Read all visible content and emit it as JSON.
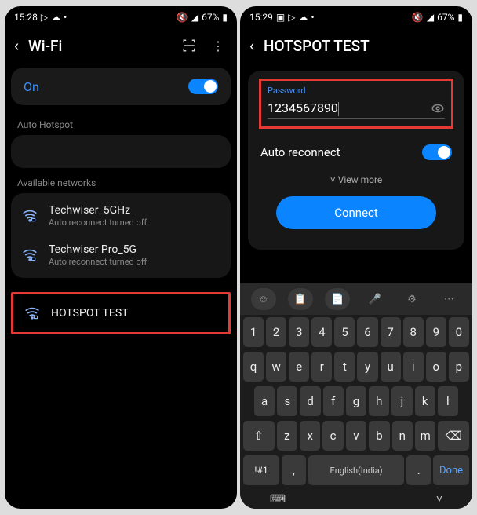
{
  "left": {
    "status": {
      "time": "15:28",
      "battery": "67%"
    },
    "header": {
      "title": "Wi-Fi"
    },
    "wifi_toggle": {
      "label": "On"
    },
    "auto_hotspot_label": "Auto Hotspot",
    "available_label": "Available networks",
    "networks": [
      {
        "name": "Techwiser_5GHz",
        "sub": "Auto reconnect turned off"
      },
      {
        "name": "Techwiser Pro_5G",
        "sub": "Auto reconnect turned off"
      }
    ],
    "highlighted_network": {
      "name": "HOTSPOT TEST"
    }
  },
  "right": {
    "status": {
      "time": "15:29",
      "battery": "67%"
    },
    "header": {
      "title": "HOTSPOT TEST"
    },
    "password": {
      "label": "Password",
      "value": "1234567890"
    },
    "auto_reconnect": {
      "label": "Auto reconnect"
    },
    "view_more": "View more",
    "connect": "Connect",
    "keyboard": {
      "row_num": [
        "1",
        "2",
        "3",
        "4",
        "5",
        "6",
        "7",
        "8",
        "9",
        "0"
      ],
      "row1": [
        "q",
        "w",
        "e",
        "r",
        "t",
        "y",
        "u",
        "i",
        "o",
        "p"
      ],
      "row2": [
        "a",
        "s",
        "d",
        "f",
        "g",
        "h",
        "j",
        "k",
        "l"
      ],
      "row3_shift": "⇧",
      "row3": [
        "z",
        "x",
        "c",
        "v",
        "b",
        "n",
        "m"
      ],
      "row3_del": "⌫",
      "row4": {
        "sym": "!#1",
        "comma": ",",
        "space": "English(India)",
        "dot": ".",
        "done": "Done"
      }
    }
  }
}
